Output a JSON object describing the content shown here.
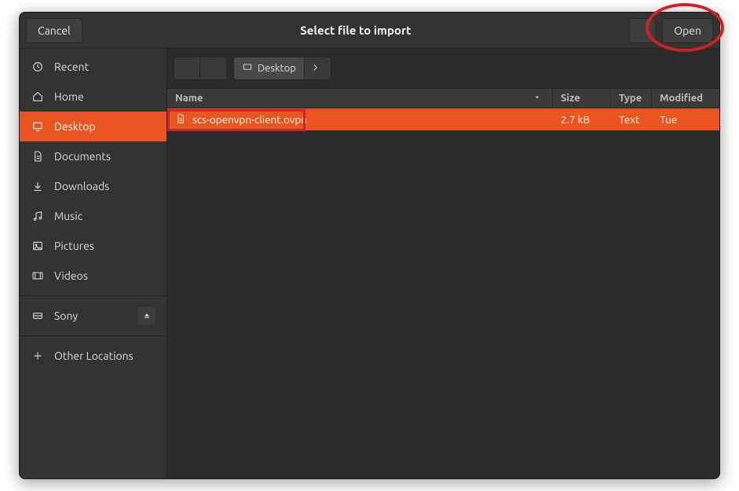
{
  "window_title": "Select file to import",
  "header": {
    "cancel_label": "Cancel",
    "open_label": "Open"
  },
  "sidebar": {
    "items": [
      {
        "id": "recent",
        "label": "Recent",
        "icon": "clock-icon"
      },
      {
        "id": "home",
        "label": "Home",
        "icon": "home-icon"
      },
      {
        "id": "desktop",
        "label": "Desktop",
        "icon": "desktop-icon",
        "selected": true
      },
      {
        "id": "documents",
        "label": "Documents",
        "icon": "documents-icon"
      },
      {
        "id": "downloads",
        "label": "Downloads",
        "icon": "downloads-icon"
      },
      {
        "id": "music",
        "label": "Music",
        "icon": "music-icon"
      },
      {
        "id": "pictures",
        "label": "Pictures",
        "icon": "pictures-icon"
      },
      {
        "id": "videos",
        "label": "Videos",
        "icon": "videos-icon"
      }
    ],
    "devices": [
      {
        "id": "sony",
        "label": "Sony",
        "icon": "drive-icon",
        "ejectable": true
      }
    ],
    "other_label": "Other Locations"
  },
  "pathbar": {
    "segments": [
      {
        "id": "home",
        "label": "",
        "icon": "home-icon"
      },
      {
        "id": "desktop",
        "label": "Desktop",
        "icon": "desktop-icon",
        "selected": true
      }
    ]
  },
  "columns": {
    "name": "Name",
    "size": "Size",
    "type": "Type",
    "modified": "Modified"
  },
  "rows": [
    {
      "name": "scs-openvpn-client.ovpn",
      "size": "2.7 kB",
      "type": "Text",
      "modified": "Tue",
      "selected": true
    }
  ],
  "colors": {
    "accent": "#e95420",
    "annotation": "#d02222"
  }
}
